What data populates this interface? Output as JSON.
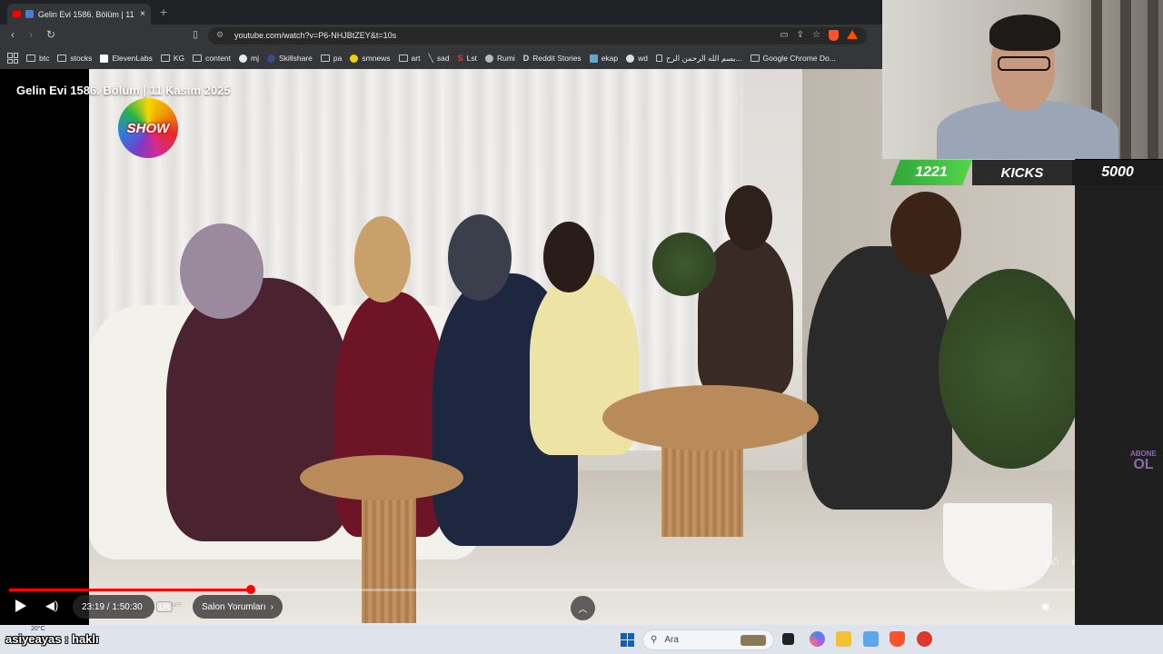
{
  "browser": {
    "tab_title": "Gelin Evi 1586. Bölüm | 11 Kas",
    "tab_close": "×",
    "new_tab": "+",
    "url": "youtube.com/watch?v=P6-NHJBtZEY&t=10s",
    "bookmarks": [
      "btc",
      "stocks",
      "ElevenLabs",
      "KG",
      "content",
      "mj",
      "Skillshare",
      "pa",
      "smnews",
      "art",
      "sad",
      "Lst",
      "Rumi",
      "Reddit Stories",
      "ekap",
      "wd",
      "بسم الله الرحمن الرح...",
      "Google Chrome Do..."
    ]
  },
  "video": {
    "title": "Gelin Evi 1586. Bölüm | 11 Kasım 2025",
    "channel_logo": "SHOW",
    "time": "23:19 / 1:50:30",
    "chapter": "Salon Yorumları",
    "progress_fraction": 0.211,
    "abone_line1": "ABONE",
    "abone_line2": "OL",
    "hd_badge": "OFF"
  },
  "overlay": {
    "count": "1221",
    "label": "KICKS",
    "goal": "5000"
  },
  "taskbar": {
    "chat_message": "asiyeayas : haklı",
    "weather": "20°C",
    "search_placeholder": "Ara"
  },
  "colors": {
    "accent_red": "#ff0000",
    "kicks_green": "#54d548"
  },
  "icons": [
    "back-icon",
    "forward-icon",
    "reload-icon",
    "bookmark-icon",
    "play-icon",
    "volume-icon",
    "like-icon",
    "dislike-icon",
    "comment-icon",
    "share-icon",
    "settings-icon",
    "subtitles-icon",
    "exit-fullscreen-icon",
    "windows-icon",
    "search-icon"
  ]
}
